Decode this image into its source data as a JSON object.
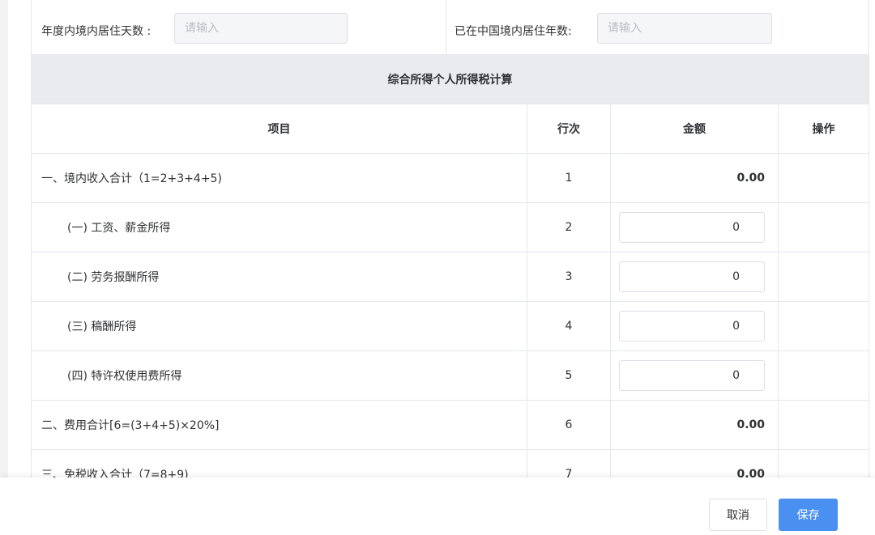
{
  "form": {
    "days_label": "年度内境内居住天数 :",
    "days_placeholder": "请输入",
    "years_label": "已在中国境内居住年数:",
    "years_placeholder": "请输入"
  },
  "table": {
    "section_title": "综合所得个人所得税计算",
    "headers": {
      "item": "项目",
      "row": "行次",
      "amount": "金额",
      "action": "操作"
    },
    "rows": [
      {
        "item": "一、境内收入合计（1=2+3+4+5)",
        "row": "1",
        "amount": "0.00"
      },
      {
        "item": "(一) 工资、薪金所得",
        "row": "2",
        "input_value": "0"
      },
      {
        "item": "(二) 劳务报酬所得",
        "row": "3",
        "input_value": "0"
      },
      {
        "item": "(三) 稿酬所得",
        "row": "4",
        "input_value": "0"
      },
      {
        "item": "(四) 特许权使用费所得",
        "row": "5",
        "input_value": "0"
      },
      {
        "item": "二、费用合计[6=(3+4+5)×20%]",
        "row": "6",
        "amount": "0.00"
      },
      {
        "item": "三、免税收入合计（7=8+9)",
        "row": "7",
        "amount": "0.00"
      }
    ]
  },
  "footer": {
    "cancel_label": "取消",
    "save_label": "保存"
  },
  "colors": {
    "primary": "#4a90f0",
    "section_bg": "#e9ebef",
    "border": "#e4e7ed"
  }
}
